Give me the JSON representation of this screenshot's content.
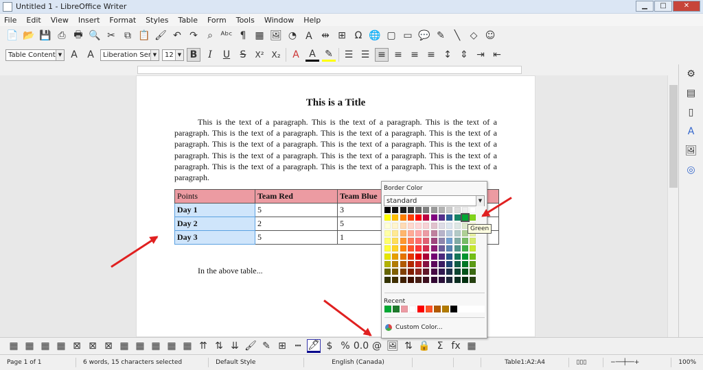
{
  "window": {
    "title": "Untitled 1 - LibreOffice Writer",
    "minimize": "▁",
    "maximize": "□",
    "close": "✕"
  },
  "menu": [
    "File",
    "Edit",
    "View",
    "Insert",
    "Format",
    "Styles",
    "Table",
    "Form",
    "Tools",
    "Window",
    "Help"
  ],
  "toolbar1": [
    "📄",
    "📂",
    "💾",
    "⎙",
    "🖶",
    "🔍",
    "✂",
    "⧉",
    "📋",
    "🖌",
    "↶",
    "↷",
    "⌕",
    "ᴬᵇᶜ",
    "¶",
    "▦",
    "🖼",
    "◔",
    "Ａ",
    "⇹",
    "⊞",
    "Ω",
    "🌐",
    "▢",
    "▭",
    "💬",
    "✎",
    "╲",
    "◇",
    "☺"
  ],
  "format_bar": {
    "paragraph_style": "Table Contents",
    "font_name": "Liberation Serif",
    "font_size": "12",
    "bold": "B",
    "italic": "I",
    "underline": "U",
    "strike": "S",
    "superscript": "X²",
    "subscript": "X₂"
  },
  "document": {
    "title": "This is a Title",
    "paragraph": "This is the text of a paragraph.  This is the text of a paragraph.  This is the text of a paragraph.  This is the text of a paragraph.  This is the text of a paragraph.  This is the text of a paragraph.  This is the text of a paragraph.  This is the text of a paragraph.  This is the text of a paragraph.  This is the text of a paragraph.  This is the text of a paragraph.  This is the text of a paragraph.  This is the text of a paragraph.  This is the text of a paragraph.  This is the text of a paragraph.",
    "table": {
      "headers": [
        "Points",
        "Team Red",
        "Team Blue",
        ""
      ],
      "rows": [
        [
          "Day 1",
          "5",
          "3",
          ""
        ],
        [
          "Day 2",
          "2",
          "5",
          ""
        ],
        [
          "Day 3",
          "5",
          "1",
          ""
        ]
      ]
    },
    "after_text": "In the above table..."
  },
  "border_popup": {
    "title": "Border Color",
    "palette": "standard",
    "recent_label": "Recent",
    "custom_label": "Custom Color...",
    "tooltip": "Green",
    "selected": "#00a933",
    "rows": [
      [
        "#000000",
        "#111111",
        "#1c1c1c",
        "#333333",
        "#666666",
        "#808080",
        "#999999",
        "#b2b2b2",
        "#cccccc",
        "#dddddd",
        "#eeeeee",
        "#ffffff"
      ],
      [
        "#ffff00",
        "#ffbf00",
        "#ff8000",
        "#ff4000",
        "#ff0000",
        "#bf0041",
        "#800080",
        "#55308d",
        "#2a6099",
        "#158466",
        "#00a933",
        "#81d41a"
      ],
      [
        "#ffffd7",
        "#fff5ce",
        "#ffdbb6",
        "#ffd8ce",
        "#ffd7d7",
        "#f7d1d5",
        "#e0c2cd",
        "#dedce6",
        "#dee6ef",
        "#dee7e5",
        "#dde8cb",
        "#f6f9d4"
      ],
      [
        "#ffff a6",
        "#ffe994",
        "#ffb66c",
        "#ffaa95",
        "#ffa6a6",
        "#ec9ba4",
        "#bf819e",
        "#b7b3ca",
        "#b4c7dc",
        "#b3cac7",
        "#afd095",
        "#e8f2a1"
      ],
      [
        "#ffff6d",
        "#ffde59",
        "#ff972f",
        "#ff7b59",
        "#ff6d6d",
        "#e16173",
        "#a1467e",
        "#8e86ae",
        "#729fcf",
        "#81aca6",
        "#77bc65",
        "#d4ea6b"
      ],
      [
        "#ffff38",
        "#ffd428",
        "#ff860d",
        "#ff5429",
        "#ff3838",
        "#d62e4e",
        "#8d1d75",
        "#6b5e9b",
        "#5983b0",
        "#50938a",
        "#3faf46",
        "#c9e831"
      ],
      [
        "#e6e600",
        "#e6a000",
        "#e67300",
        "#e63600",
        "#e60000",
        "#ac0037",
        "#730073",
        "#4c2a7e",
        "#25558a",
        "#137659",
        "#00962e",
        "#74bf17"
      ],
      [
        "#b2b200",
        "#b27b00",
        "#b25a00",
        "#b22a00",
        "#c9211e",
        "#861141",
        "#5c085c",
        "#3b1d63",
        "#1c4472",
        "#0f5d45",
        "#007824",
        "#5b9b14"
      ],
      [
        "#666600",
        "#806000",
        "#814000",
        "#801f00",
        "#8d281e",
        "#611729",
        "#470a45",
        "#311950",
        "#1c3048",
        "#0c4532",
        "#00531a",
        "#3b6a12"
      ],
      [
        "#333300",
        "#403000",
        "#402000",
        "#401000",
        "#471e14",
        "#3d0f1e",
        "#330833",
        "#2a103a",
        "#1d2638",
        "#0a2e20",
        "#00300f",
        "#274211"
      ]
    ],
    "recent": [
      "#00a933",
      "#1e7a2c",
      "#ec9ba4",
      "#ffffff",
      "#ff0000",
      "#ff5429",
      "#b25a00",
      "#b27b00",
      "#000000"
    ]
  },
  "status": {
    "page": "Page 1 of 1",
    "words": "6 words, 15 characters selected",
    "style": "Default Style",
    "language": "English (Canada)",
    "cell": "Table1:A2:A4",
    "zoom": "100%"
  }
}
